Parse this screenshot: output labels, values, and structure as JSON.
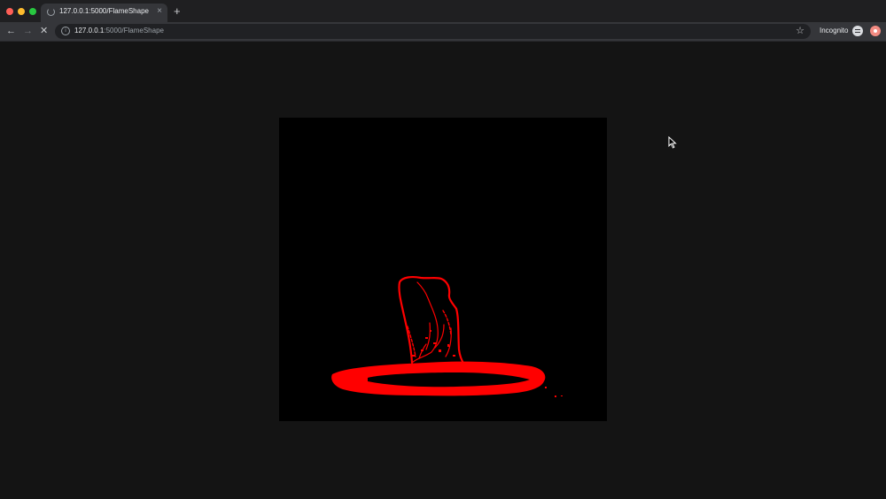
{
  "browser": {
    "tab": {
      "title": "127.0.0.1:5000/FlameShape",
      "close": "×"
    },
    "new_tab": "+",
    "nav": {
      "back": "←",
      "forward": "→",
      "stop": "✕"
    },
    "address": {
      "host": "127.0.0.1",
      "path": ":5000/FlameShape",
      "info": "i"
    },
    "bookmark_star": "☆",
    "profile_label": "Incognito"
  },
  "page": {
    "canvas_background": "#000000",
    "flame_color": "#ff0000"
  }
}
